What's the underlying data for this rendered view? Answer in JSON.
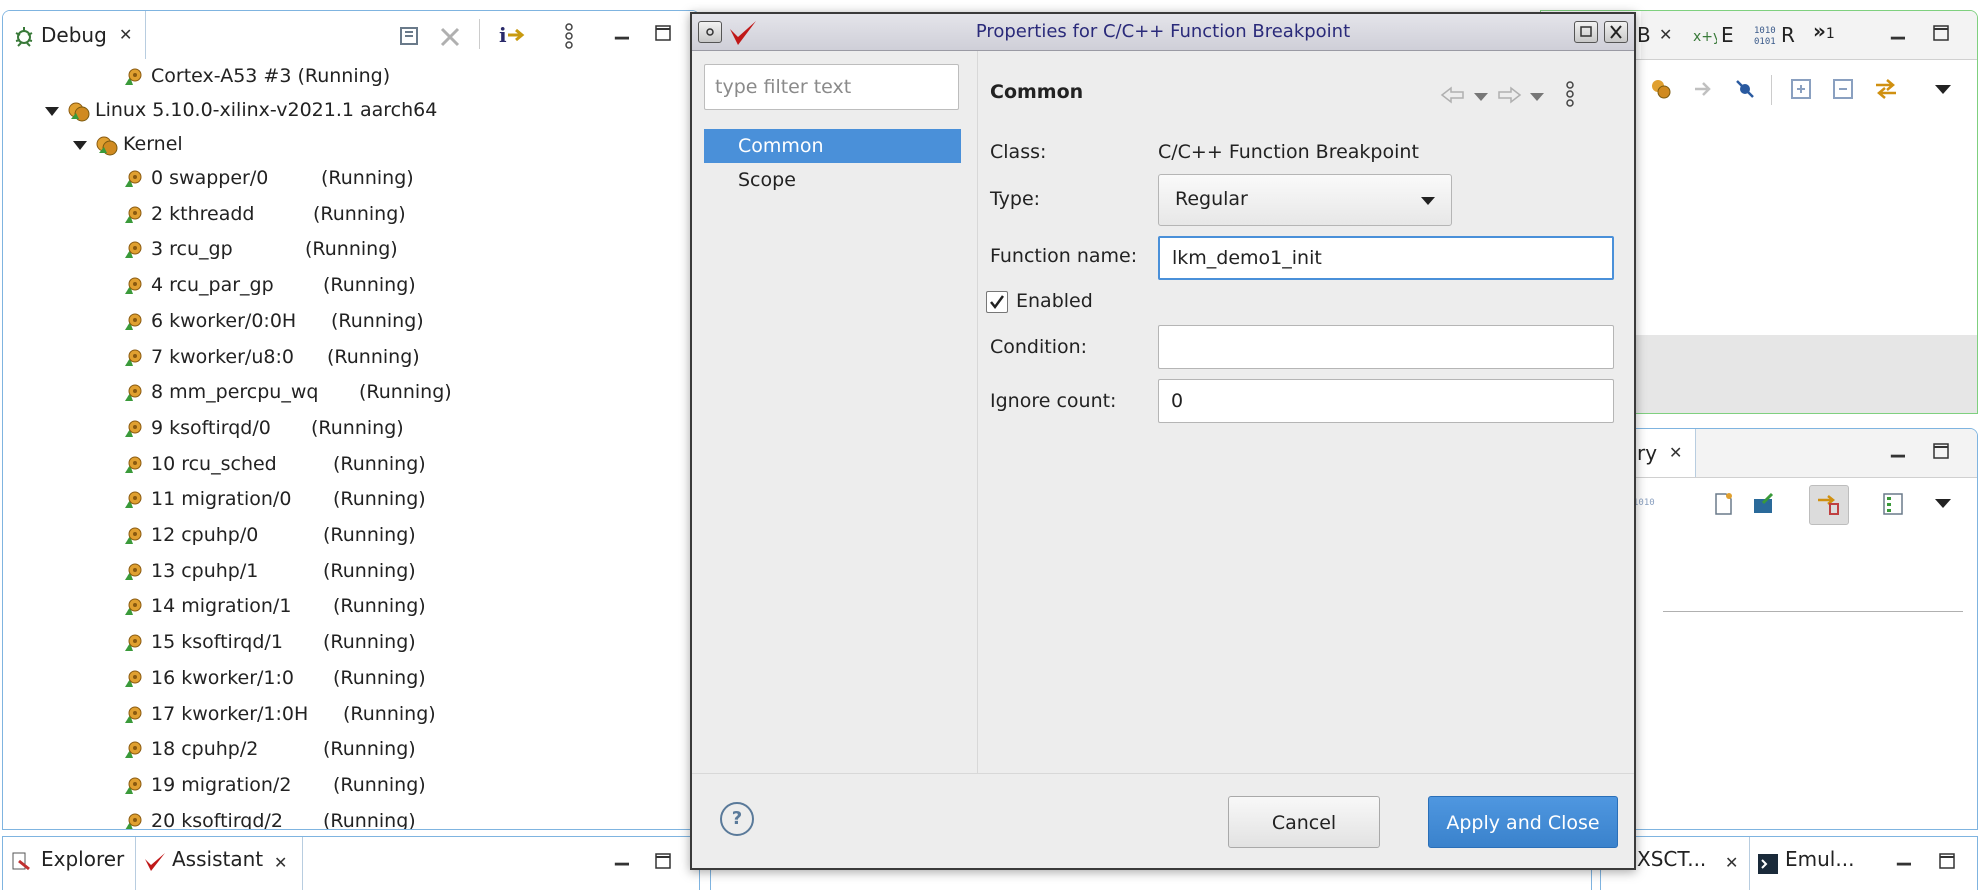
{
  "debug_view": {
    "tab_label": "Debug",
    "top_item": {
      "name": "Cortex-A53 #3 (Running)"
    },
    "linux_node": {
      "label": "Linux 5.10.0-xilinx-v2021.1 aarch64"
    },
    "kernel_node": {
      "label": "Kernel"
    },
    "threads": [
      {
        "name": "0 swapper/0",
        "state": "(Running)"
      },
      {
        "name": "2 kthreadd",
        "state": "(Running)"
      },
      {
        "name": "3 rcu_gp",
        "state": "(Running)"
      },
      {
        "name": "4 rcu_par_gp",
        "state": "(Running)"
      },
      {
        "name": "6 kworker/0:0H",
        "state": "(Running)"
      },
      {
        "name": "7 kworker/u8:0",
        "state": "(Running)"
      },
      {
        "name": "8 mm_percpu_wq",
        "state": "(Running)"
      },
      {
        "name": "9 ksoftirqd/0",
        "state": "(Running)"
      },
      {
        "name": "10 rcu_sched",
        "state": "(Running)"
      },
      {
        "name": "11 migration/0",
        "state": "(Running)"
      },
      {
        "name": "12 cpuhp/0",
        "state": "(Running)"
      },
      {
        "name": "13 cpuhp/1",
        "state": "(Running)"
      },
      {
        "name": "14 migration/1",
        "state": "(Running)"
      },
      {
        "name": "15 ksoftirqd/1",
        "state": "(Running)"
      },
      {
        "name": "16 kworker/1:0",
        "state": "(Running)"
      },
      {
        "name": "17 kworker/1:0H",
        "state": "(Running)"
      },
      {
        "name": "18 cpuhp/2",
        "state": "(Running)"
      },
      {
        "name": "19 migration/2",
        "state": "(Running)"
      },
      {
        "name": "20 ksoftirqd/2",
        "state": "(Running)"
      }
    ]
  },
  "right_top_view": {
    "tabs": [
      {
        "label": "B"
      },
      {
        "label": "E"
      },
      {
        "label": "R"
      },
      {
        "label": "1",
        "overflow_prefix": "»"
      }
    ]
  },
  "right_mid_view": {
    "tab_label": "ry"
  },
  "bottom_left": {
    "tabs": [
      {
        "label": "Explorer"
      },
      {
        "label": "Assistant"
      }
    ]
  },
  "bottom_right": {
    "tabs": [
      {
        "label": "XSCT..."
      },
      {
        "label": "Emul..."
      }
    ]
  },
  "dialog": {
    "title": "Properties for C/C++ Function Breakpoint",
    "filter": {
      "placeholder": "type filter text",
      "value": ""
    },
    "nav": [
      {
        "label": "Common",
        "selected": true
      },
      {
        "label": "Scope",
        "selected": false
      }
    ],
    "page_heading": "Common",
    "class_label": "Class:",
    "class_value": "C/C++ Function Breakpoint",
    "type_label": "Type:",
    "type_value": "Regular",
    "function_name_label": "Function name:",
    "function_name_value": "lkm_demo1_init",
    "enabled_label": "Enabled",
    "enabled_checked": true,
    "condition_label": "Condition:",
    "condition_value": "",
    "ignore_count_label": "Ignore count:",
    "ignore_count_value": "0",
    "cancel_label": "Cancel",
    "apply_close_label": "Apply and Close",
    "help_glyph": "?"
  },
  "colors": {
    "accent": "#4a90d9",
    "primary_button": "#3a82cc",
    "view_border": "#7fb4e0"
  }
}
